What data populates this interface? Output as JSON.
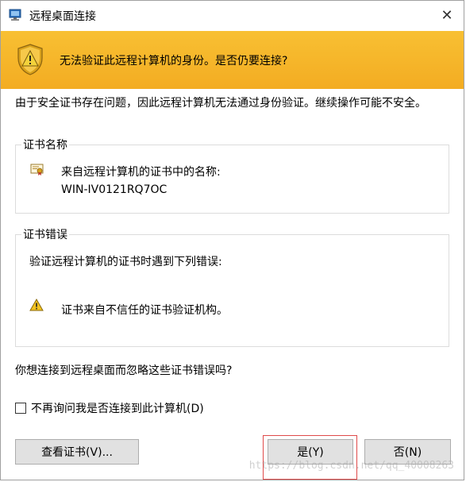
{
  "window": {
    "title": "远程桌面连接",
    "close_glyph": "✕"
  },
  "banner": {
    "text": "无法验证此远程计算机的身份。是否仍要连接?",
    "color": "#f5b12a"
  },
  "intro": {
    "text": "由于安全证书存在问题，因此远程计算机无法通过身份验证。继续操作可能不安全。"
  },
  "cert_name_group": {
    "label": "证书名称",
    "line1": "来自远程计算机的证书中的名称:",
    "line2": "WIN-IV0121RQ7OC"
  },
  "cert_error_group": {
    "label": "证书错误",
    "line1": "验证远程计算机的证书时遇到下列错误:",
    "error": "证书来自不信任的证书验证机构。"
  },
  "question": {
    "text": "你想连接到远程桌面而忽略这些证书错误吗?"
  },
  "checkbox": {
    "label": "不再询问我是否连接到此计算机(D)",
    "checked": false
  },
  "buttons": {
    "view_cert": "查看证书(V)...",
    "yes": "是(Y)",
    "no": "否(N)"
  },
  "watermark": {
    "text": "https://blog.csdn.net/qq_40008263"
  },
  "icons": {
    "title": "remote-desktop-icon",
    "banner": "warning-shield-icon",
    "cert": "certificate-icon",
    "warn": "warning-triangle-icon"
  }
}
